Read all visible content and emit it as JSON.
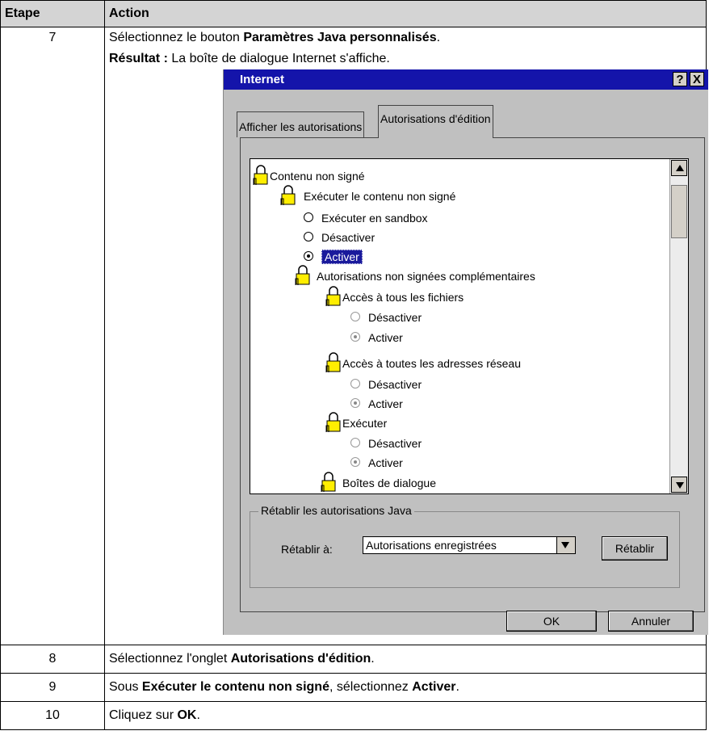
{
  "table": {
    "headers": {
      "step": "Etape",
      "action": "Action"
    },
    "step7": {
      "number": "7",
      "line1_prefix": "Sélectionnez le bouton ",
      "line1_bold": "Paramètres Java personnalisés",
      "line1_suffix": ".",
      "line2_bold": "Résultat :",
      "line2_text": " La boîte de dialogue Internet s'affiche."
    },
    "step8": {
      "number": "8",
      "prefix": "Sélectionnez l'onglet ",
      "bold": "Autorisations d'édition",
      "suffix": "."
    },
    "step9": {
      "number": "9",
      "prefix": "Sous ",
      "bold1": "Exécuter le contenu non signé",
      "middle": ", sélectionnez ",
      "bold2": "Activer",
      "suffix": "."
    },
    "step10": {
      "number": "10",
      "prefix": "Cliquez sur ",
      "bold": "OK",
      "suffix": "."
    }
  },
  "dialog": {
    "title": "Internet",
    "help_label": "?",
    "close_label": "X",
    "tabs": [
      "Afficher les autorisations",
      "Autorisations d'édition"
    ],
    "active_tab": 1,
    "tree": {
      "root": "Contenu non signé",
      "run_unsigned": "Exécuter le contenu non signé",
      "run_options": [
        "Exécuter en sandbox",
        "Désactiver",
        "Activer"
      ],
      "run_selected": "Activer",
      "additional": "Autorisations non signées complémentaires",
      "file_access": "Accès à tous les fichiers",
      "file_options": [
        "Désactiver",
        "Activer"
      ],
      "network_access": "Accès à toutes les adresses réseau",
      "network_options": [
        "Désactiver",
        "Activer"
      ],
      "execute": "Exécuter",
      "execute_options": [
        "Désactiver",
        "Activer"
      ],
      "dialogs": "Boîtes de dialogue"
    },
    "reset_group": {
      "title": "Rétablir les autorisations Java",
      "label": "Rétablir à:",
      "combo_value": "Autorisations enregistrées",
      "reset_button": "Rétablir"
    },
    "ok_button": "OK",
    "cancel_button": "Annuler"
  }
}
